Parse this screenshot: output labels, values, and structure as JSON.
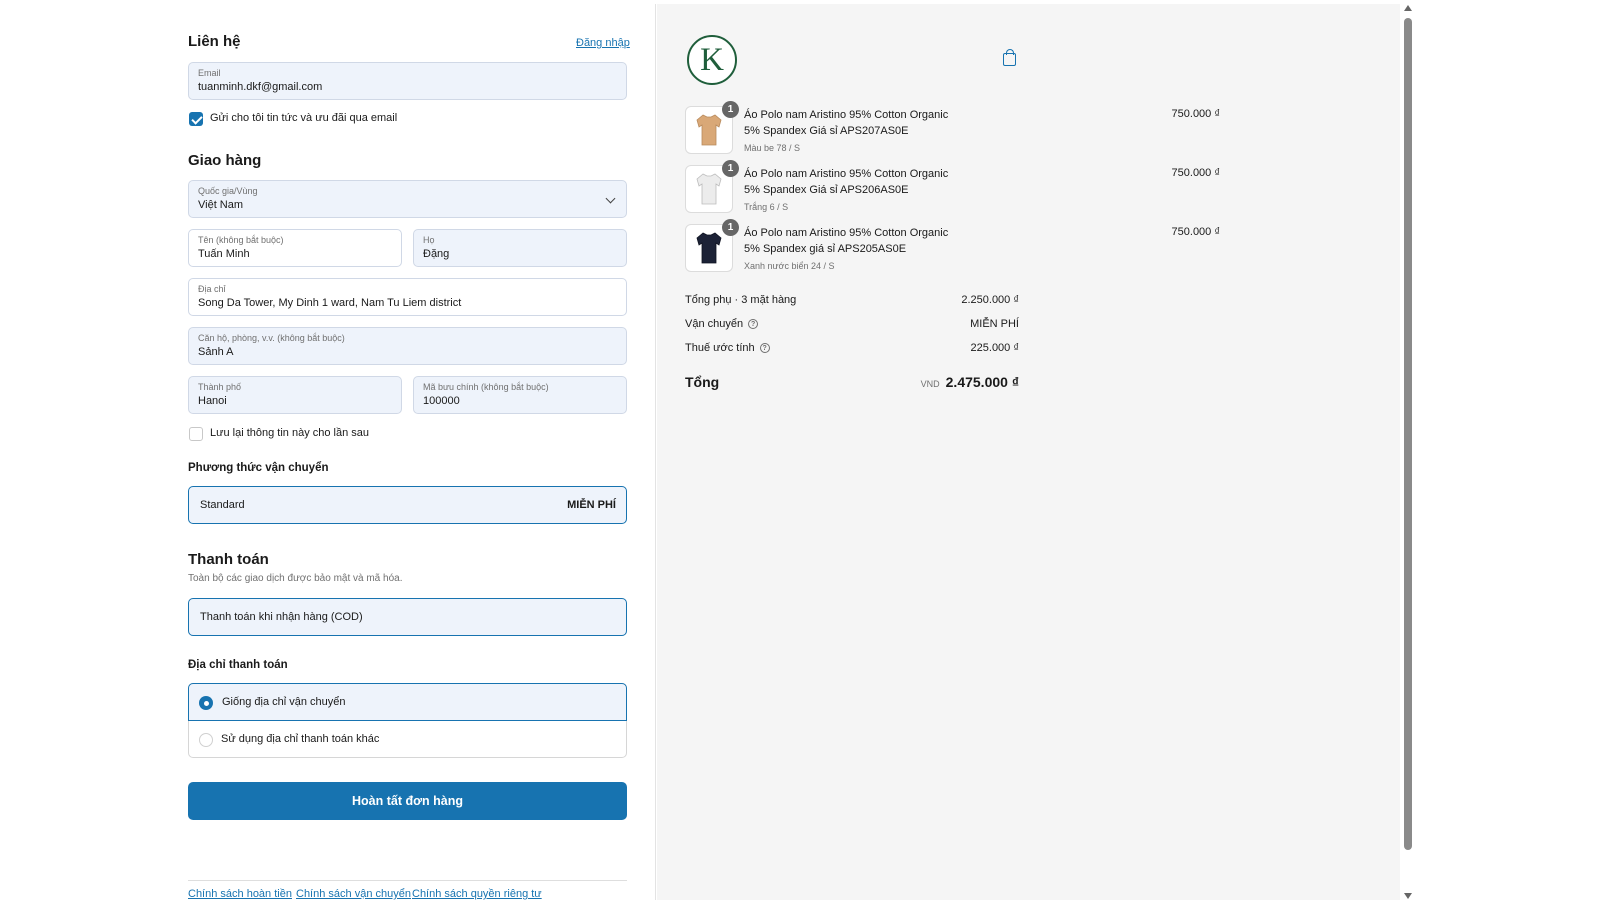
{
  "contact": {
    "title": "Liên hệ",
    "login_link": "Đăng nhập",
    "email_label": "Email",
    "email_value": "tuanminh.dkf@gmail.com",
    "newsletter_label": "Gửi cho tôi tin tức và ưu đãi qua email",
    "newsletter_checked": true
  },
  "delivery": {
    "title": "Giao hàng",
    "country_label": "Quốc gia/Vùng",
    "country_value": "Việt Nam",
    "first_name_label": "Tên (không bắt buộc)",
    "first_name_value": "Tuấn Minh",
    "last_name_label": "Họ",
    "last_name_value": "Đặng",
    "address_label": "Địa chỉ",
    "address_value": "Song Da Tower, My Dinh 1 ward, Nam Tu Liem district",
    "apartment_label": "Căn hộ, phòng, v.v. (không bắt buộc)",
    "apartment_value": "Sảnh A",
    "city_label": "Thành phố",
    "city_value": "Hanoi",
    "postal_label": "Mã bưu chính (không bắt buộc)",
    "postal_value": "100000",
    "save_info_label": "Lưu lại thông tin này cho lần sau",
    "save_info_checked": false
  },
  "shipping_method": {
    "title": "Phương thức vận chuyển",
    "option_name": "Standard",
    "option_price": "MIỄN PHÍ"
  },
  "payment": {
    "title": "Thanh toán",
    "subtitle": "Toàn bộ các giao dịch được bảo mật và mã hóa.",
    "method": "Thanh toán khi nhận hàng (COD)"
  },
  "billing": {
    "title": "Địa chỉ thanh toán",
    "option_same": "Giống địa chỉ vận chuyển",
    "option_other": "Sử dụng địa chỉ thanh toán khác",
    "selected": "same"
  },
  "complete_button": "Hoàn tất đơn hàng",
  "footer_links": [
    "Chính sách hoàn tiền",
    "Chính sách vận chuyển",
    "Chính sách quyền riêng tư"
  ],
  "cart": {
    "logo_letter": "K",
    "items": [
      {
        "qty": "1",
        "name": "Áo Polo nam Aristino 95% Cotton Organic 5% Spandex Giá sỉ APS207AS0E",
        "variant": "Màu be 78 / S",
        "price": "750.000 ₫",
        "color": "#d9a877"
      },
      {
        "qty": "1",
        "name": "Áo Polo nam Aristino 95% Cotton Organic 5% Spandex Giá sỉ APS206AS0E",
        "variant": "Trắng 6 / S",
        "price": "750.000 ₫",
        "color": "#ececec"
      },
      {
        "qty": "1",
        "name": "Áo Polo nam Aristino 95% Cotton Organic 5% Spandex giá sỉ APS205AS0E",
        "variant": "Xanh nước biển 24 / S",
        "price": "750.000 ₫",
        "color": "#1c2236"
      }
    ],
    "subtotal_label": "Tổng phụ · 3 mặt hàng",
    "subtotal_value": "2.250.000 ₫",
    "shipping_label": "Vận chuyển",
    "shipping_value": "MIỄN PHÍ",
    "tax_label": "Thuế ước tính",
    "tax_value": "225.000 ₫",
    "total_label": "Tổng",
    "currency": "VND",
    "total_value": "2.475.000 ₫"
  },
  "colors": {
    "accent": "#1773b0",
    "field_bg": "#eef3fb",
    "summary_bg": "#f5f5f5",
    "logo_green": "#1f5e3b"
  }
}
